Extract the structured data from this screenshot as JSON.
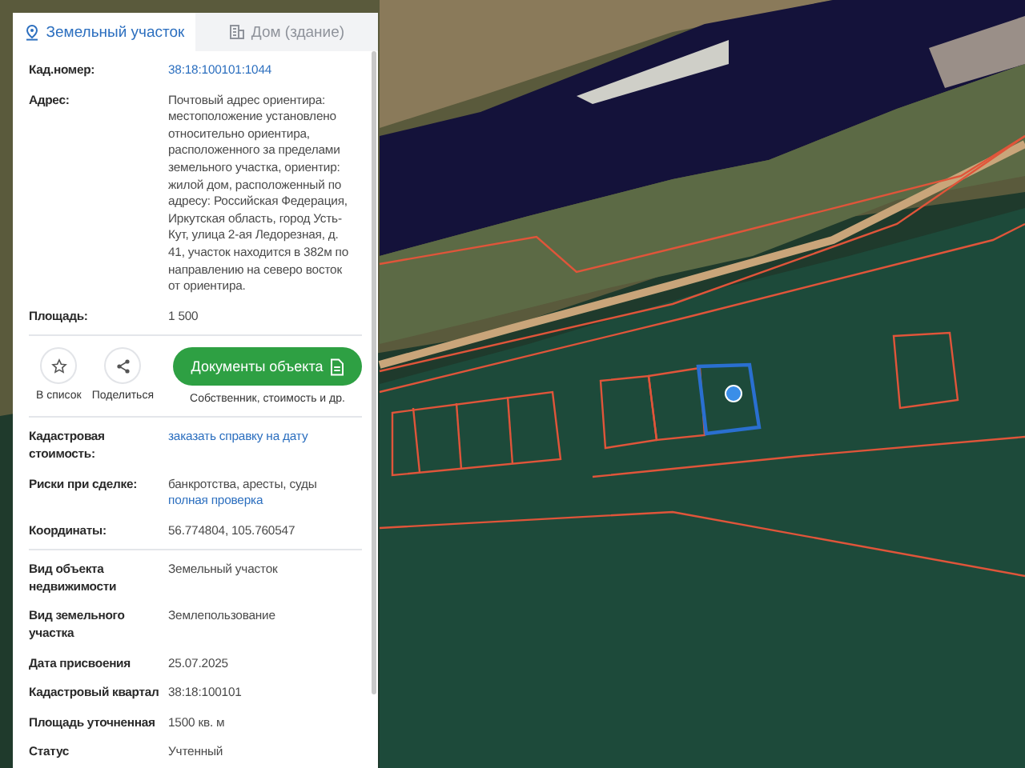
{
  "tabs": [
    {
      "label": "Земельный участок",
      "selected": true,
      "kind": "parcel"
    },
    {
      "label": "Дом (здание)",
      "selected": false,
      "kind": "building"
    }
  ],
  "sections": [
    {
      "kind": "rows",
      "rows": [
        {
          "label": "Кад.номер:",
          "values": [
            {
              "kind": "link",
              "text": "38:18:100101:1044"
            }
          ]
        },
        {
          "label": "Адрес:",
          "values": [
            {
              "kind": "text",
              "text": "Почтовый адрес ориентира: местоположение установлено относительно ориентира, расположенного за пределами земельного участка, ориентир: жилой дом, расположенный по адресу: Российская Федерация, Иркутская область, город Усть-Кут, улица 2-ая Ледорезная, д. 41, участок находится в 382м по направлению на северо восток от ориентира."
            }
          ]
        },
        {
          "label": "Площадь:",
          "values": [
            {
              "kind": "text",
              "text": "1 500"
            }
          ]
        }
      ]
    },
    {
      "kind": "actions",
      "round_buttons": [
        {
          "kind": "star",
          "label": "В список"
        },
        {
          "kind": "share",
          "label": "Поделиться"
        }
      ],
      "main_button": {
        "label": "Документы объекта",
        "caption": "Собственник, стоимость и др."
      }
    },
    {
      "kind": "rows",
      "rows": [
        {
          "label": "Кадастровая стоимость:",
          "values": [
            {
              "kind": "link",
              "text": "заказать справку на дату"
            }
          ]
        },
        {
          "label": "Риски при сделке:",
          "values": [
            {
              "kind": "text",
              "text": "банкротства, аресты, суды"
            },
            {
              "kind": "link",
              "text": "полная проверка"
            }
          ]
        },
        {
          "label": "Координаты:",
          "values": [
            {
              "kind": "text",
              "text": "56.774804, 105.760547"
            }
          ]
        }
      ]
    },
    {
      "kind": "rows",
      "rows": [
        {
          "label": "Вид объекта недвижимости",
          "values": [
            {
              "kind": "text",
              "text": "Земельный участок"
            }
          ]
        },
        {
          "label": "Вид земельного участка",
          "values": [
            {
              "kind": "text",
              "text": "Землепользование"
            }
          ]
        },
        {
          "label": "Дата присвоения",
          "values": [
            {
              "kind": "text",
              "text": "25.07.2025"
            }
          ]
        },
        {
          "label": "Кадастровый квартал",
          "values": [
            {
              "kind": "text",
              "text": "38:18:100101"
            }
          ]
        },
        {
          "label": "Площадь уточненная",
          "values": [
            {
              "kind": "text",
              "text": "1500 кв. м"
            }
          ]
        },
        {
          "label": "Статус",
          "values": [
            {
              "kind": "text",
              "text": "Учтенный"
            }
          ]
        }
      ]
    }
  ]
}
